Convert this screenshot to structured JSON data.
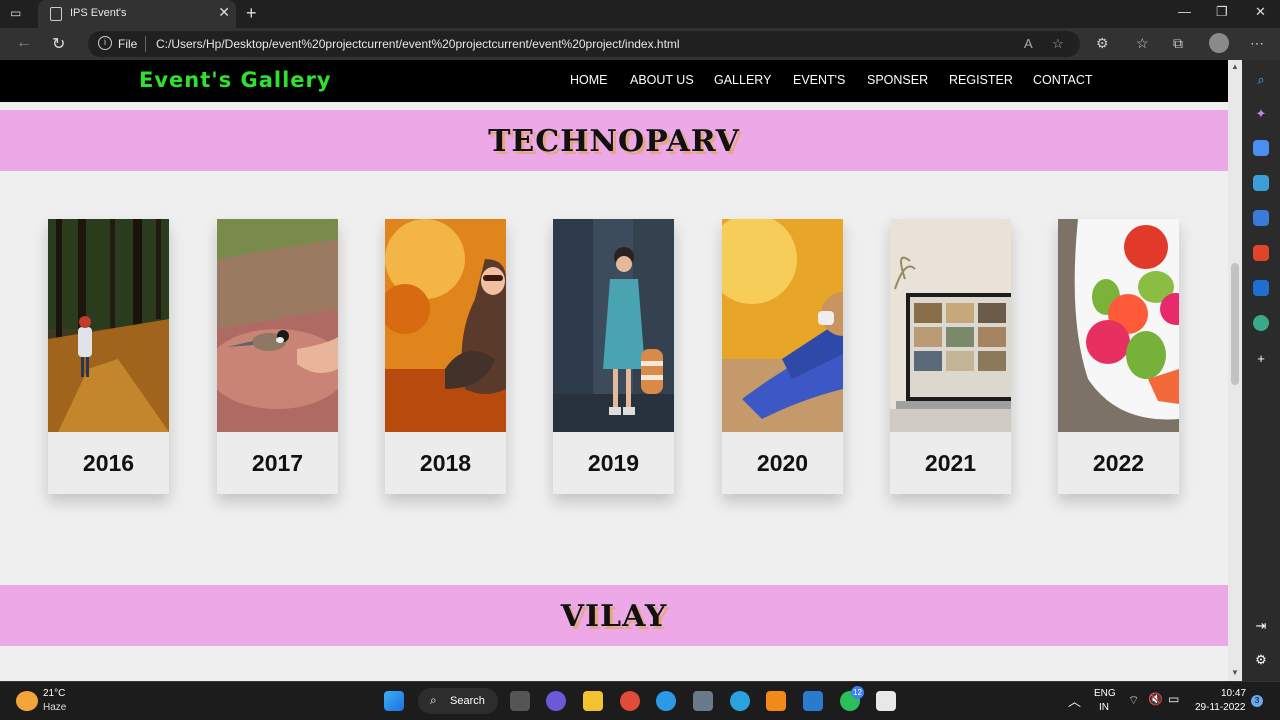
{
  "browser": {
    "tab_title": "IPS Event's",
    "new_tab_label": "+",
    "address_scheme": "File",
    "address_url": "C:/Users/Hp/Desktop/event%20projectcurrent/event%20projectcurrent/event%20project/index.html"
  },
  "site": {
    "brand": "Event's Gallery",
    "nav": [
      "HOME",
      "ABOUT US",
      "GALLERY",
      "EVENT'S",
      "SPONSER",
      "REGISTER",
      "CONTACT"
    ],
    "sections": [
      {
        "title": "TECHNOPARV",
        "cards": [
          {
            "year": "2016",
            "image": "autumn forest path with child"
          },
          {
            "year": "2017",
            "image": "bird on hand"
          },
          {
            "year": "2018",
            "image": "woman in autumn leaves"
          },
          {
            "year": "2019",
            "image": "girl in blue dress with bag"
          },
          {
            "year": "2020",
            "image": "person sitting in golden field"
          },
          {
            "year": "2021",
            "image": "laptop on desk"
          },
          {
            "year": "2022",
            "image": "bowl of fruit"
          }
        ]
      },
      {
        "title": "VILAY",
        "cards": []
      }
    ]
  },
  "taskbar": {
    "weather_temp": "21°C",
    "weather_condition": "Haze",
    "search_label": "Search",
    "language_line1": "ENG",
    "language_line2": "IN",
    "time": "10:47",
    "date": "29-11-2022",
    "whatsapp_badge": "12",
    "notification_count": "3"
  },
  "colors": {
    "brand": "#2fe12f",
    "banner": "#eda8e8",
    "nav_bg": "#000000",
    "page_bg": "#efefef"
  }
}
